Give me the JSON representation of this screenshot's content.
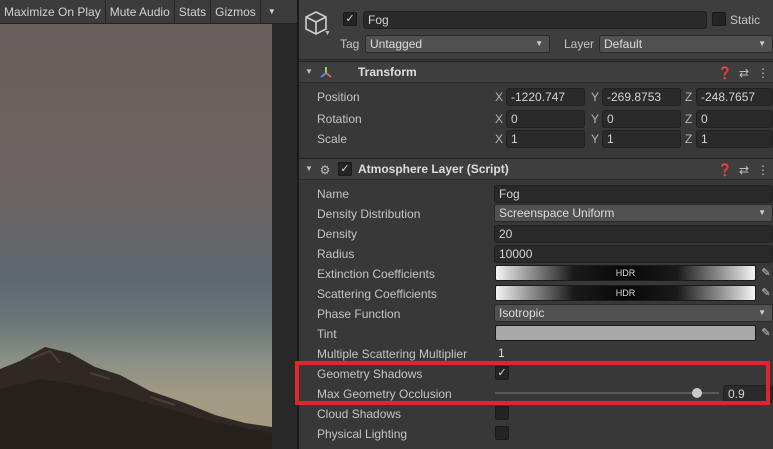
{
  "toolbar": {
    "maximize_label": "Maximize On Play",
    "mute_label": "Mute Audio",
    "stats_label": "Stats",
    "gizmos_label": "Gizmos",
    "dropdown_icon": "triangle-down-icon"
  },
  "gameobject": {
    "name": "Fog",
    "active": true,
    "static_label": "Static",
    "tag_label": "Tag",
    "tag_value": "Untagged",
    "layer_label": "Layer",
    "layer_value": "Default"
  },
  "transform": {
    "title": "Transform",
    "position_label": "Position",
    "rotation_label": "Rotation",
    "scale_label": "Scale",
    "axis_x": "X",
    "axis_y": "Y",
    "axis_z": "Z",
    "position": {
      "x": "-1220.747",
      "y": "-269.8753",
      "z": "-248.7657"
    },
    "rotation": {
      "x": "0",
      "y": "0",
      "z": "0"
    },
    "scale": {
      "x": "1",
      "y": "1",
      "z": "1"
    }
  },
  "atmosphere": {
    "title": "Atmosphere Layer (Script)",
    "enabled": true,
    "name_label": "Name",
    "name_value": "Fog",
    "density_distribution_label": "Density Distribution",
    "density_distribution_value": "Screenspace Uniform",
    "density_label": "Density",
    "density_value": "20",
    "radius_label": "Radius",
    "radius_value": "10000",
    "extinction_label": "Extinction Coefficients",
    "scattering_label": "Scattering Coefficients",
    "hdr_label": "HDR",
    "phase_function_label": "Phase Function",
    "phase_function_value": "Isotropic",
    "tint_label": "Tint",
    "tint_color": "#a8a8a8",
    "multiple_scattering_label": "Multiple Scattering Multiplier",
    "multiple_scattering_value": "1",
    "geometry_shadows_label": "Geometry Shadows",
    "geometry_shadows": true,
    "max_geometry_occlusion_label": "Max Geometry Occlusion",
    "max_geometry_occlusion_value": "0.9",
    "max_geometry_occlusion_fraction": 0.9,
    "cloud_shadows_label": "Cloud Shadows",
    "cloud_shadows": false,
    "physical_lighting_label": "Physical Lighting",
    "physical_lighting": false
  },
  "colors": {
    "highlight": "#e0262b",
    "panel_bg": "#383838"
  }
}
